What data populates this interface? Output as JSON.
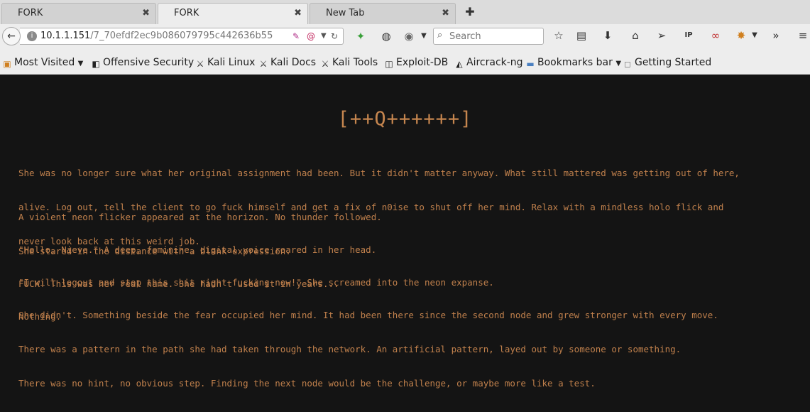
{
  "tabs": [
    {
      "title": "FORK",
      "close": "✖"
    },
    {
      "title": "FORK",
      "close": "✖"
    },
    {
      "title": "New Tab",
      "close": "✖"
    }
  ],
  "new_tab_glyph": "✚",
  "url": {
    "host": "10.1.1.151",
    "path": "/7_70efdf2ec9b086079795c442636b55"
  },
  "search": {
    "placeholder": "Search"
  },
  "bookmarks": [
    {
      "label": "Most Visited",
      "icon": "most-visited-icon"
    },
    {
      "label": "Offensive Security",
      "icon": "offsec-icon"
    },
    {
      "label": "Kali Linux",
      "icon": "kali-icon"
    },
    {
      "label": "Kali Docs",
      "icon": "kali-icon"
    },
    {
      "label": "Kali Tools",
      "icon": "kali-icon"
    },
    {
      "label": "Exploit-DB",
      "icon": "exploitdb-icon"
    },
    {
      "label": "Aircrack-ng",
      "icon": "aircrack-icon"
    },
    {
      "label": "Bookmarks bar",
      "icon": "folder-icon"
    },
    {
      "label": "Getting Started",
      "icon": "page-icon"
    }
  ],
  "page": {
    "heading": "[++Q++++++]",
    "paragraphs": [
      [
        "She was no longer sure what her original assignment had been. But it didn't matter anyway. What still mattered was getting out of here,",
        "alive. Log out, tell the client to go fuck himself and get a fix of n0ise to shut off her mind. Relax with a mindless holo flick and",
        "never look back at this weird job."
      ],
      [
        "A violent neon flicker appeared at the horizon. No thunder followed.",
        "She stared in the distance with a blank expression."
      ],
      [
        "\"Hello, Nieve.\" A deep, feminine, digital voice roared in her head.",
        "FUCK! This was her real name. She hadn't used it in years..."
      ],
      [
        "\"I will logout and stop this shit right fucking now!\" She screamed into the neon expanse.",
        "Nothing."
      ],
      [
        "She didn't. Something beside the fear occupied her mind. It had been there since the second node and grew stronger with every move.",
        "There was a pattern in the path she had taken through the network. An artificial pattern, layed out by someone or something.",
        "There was no hint, no obvious step. Finding the next node would be the challenge, or maybe more like a test."
      ]
    ]
  },
  "colors": {
    "page_bg": "#141414",
    "text": "#c0804c",
    "chrome": "#ededed"
  }
}
